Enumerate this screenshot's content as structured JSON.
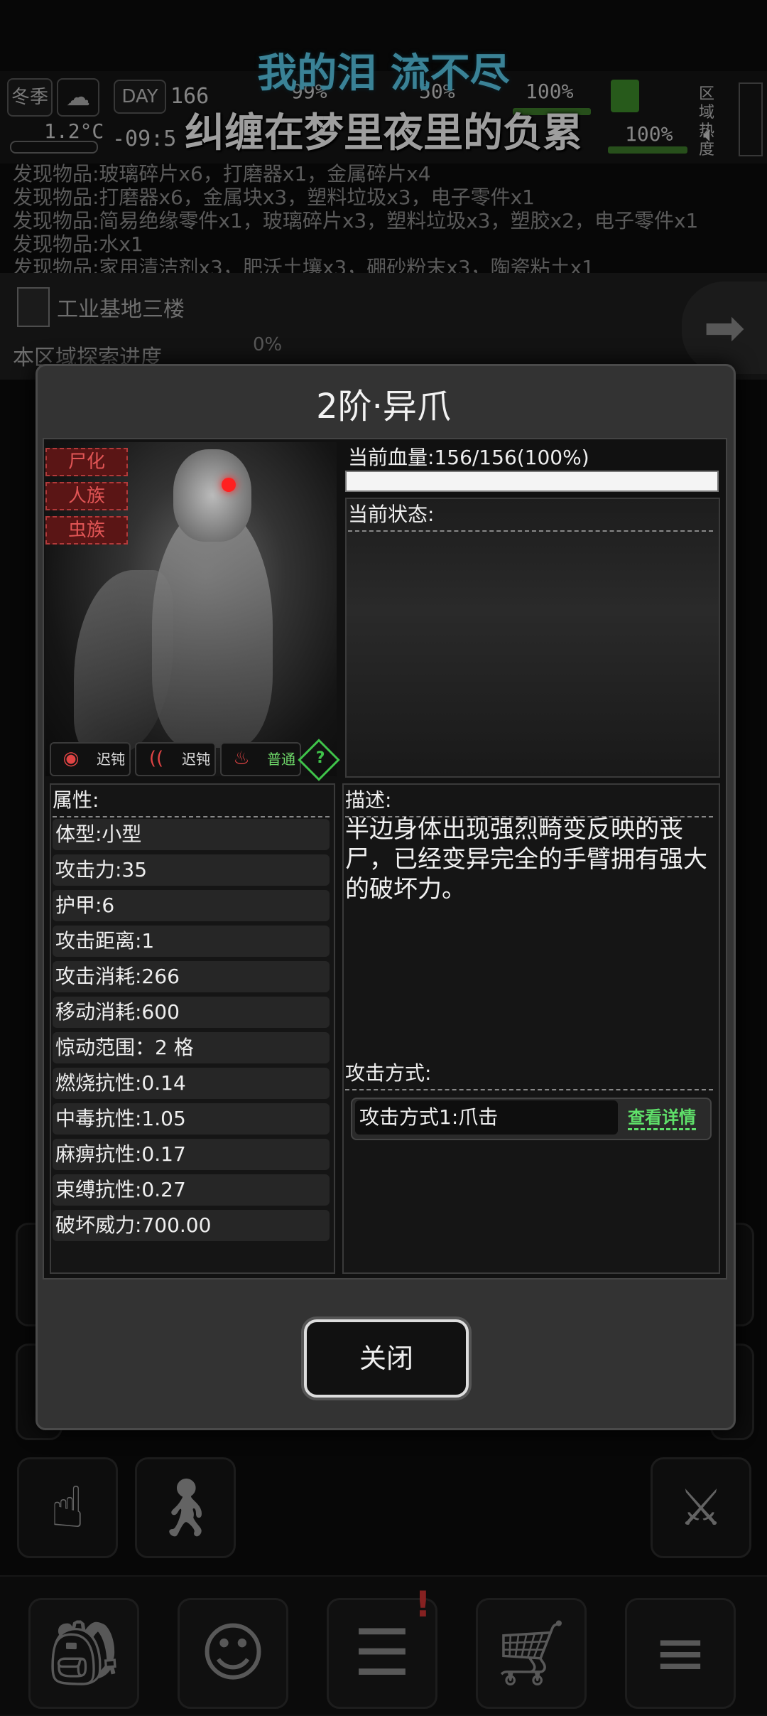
{
  "topbar": {
    "season": "冬季",
    "temperature": "1.2°C",
    "day_label": "DAY",
    "day_value": "166",
    "time": "-09:5",
    "stat1": "99%",
    "stat2": "50%",
    "stat3": "100%",
    "stat4": "100%",
    "region_label": "区域热度"
  },
  "lyrics": {
    "line1": "我的泪 流不尽",
    "line2": "纠缠在梦里夜里的负累"
  },
  "log": [
    "发现物品:玻璃碎片x6，打磨器x1，金属碎片x4",
    "发现物品:打磨器x6，金属块x3，塑料垃圾x3，电子零件x1",
    "发现物品:简易绝缘零件x1，玻璃碎片x3，塑料垃圾x3，塑胶x2，电子零件x1",
    "发现物品:水x1",
    "发现物品:家用清洁剂x3，肥沃土壤x3，硼砂粉末x3，陶瓷粘土x1"
  ],
  "location": {
    "name": "工业基地三楼",
    "progress_label": "本区域探索进度",
    "progress_value": "0%"
  },
  "modal": {
    "title": "2阶·异爪",
    "tags": [
      "尸化",
      "人族",
      "虫族"
    ],
    "senses": [
      {
        "icon": "eye-icon",
        "label": "迟钝"
      },
      {
        "icon": "ear-icon",
        "label": "迟钝"
      },
      {
        "icon": "nose-icon",
        "label": "普通"
      }
    ],
    "help": "?",
    "hp_text": "当前血量:156/156(100%)",
    "hp_fraction": 1.0,
    "status_label": "当前状态:",
    "attr_label": "属性:",
    "attributes": [
      "体型:小型",
      "攻击力:35",
      "护甲:6",
      "攻击距离:1",
      "攻击消耗:266",
      "移动消耗:600",
      "惊动范围：2 格",
      "燃烧抗性:0.14",
      "中毒抗性:1.05",
      "麻痹抗性:0.17",
      "束缚抗性:0.27",
      "破坏威力:700.00"
    ],
    "desc_label": "描述:",
    "description": "半边身体出现强烈畸变反映的丧尸，已经变异完全的手臂拥有强大的破坏力。",
    "attack_label": "攻击方式:",
    "attack_name": "攻击方式1:爪击",
    "attack_detail": "查看详情",
    "close": "关闭"
  },
  "bottom_nav": [
    {
      "icon": "backpack-icon"
    },
    {
      "icon": "brain-icon"
    },
    {
      "icon": "notebook-icon"
    },
    {
      "icon": "cart-icon"
    },
    {
      "icon": "menu-icon"
    }
  ]
}
